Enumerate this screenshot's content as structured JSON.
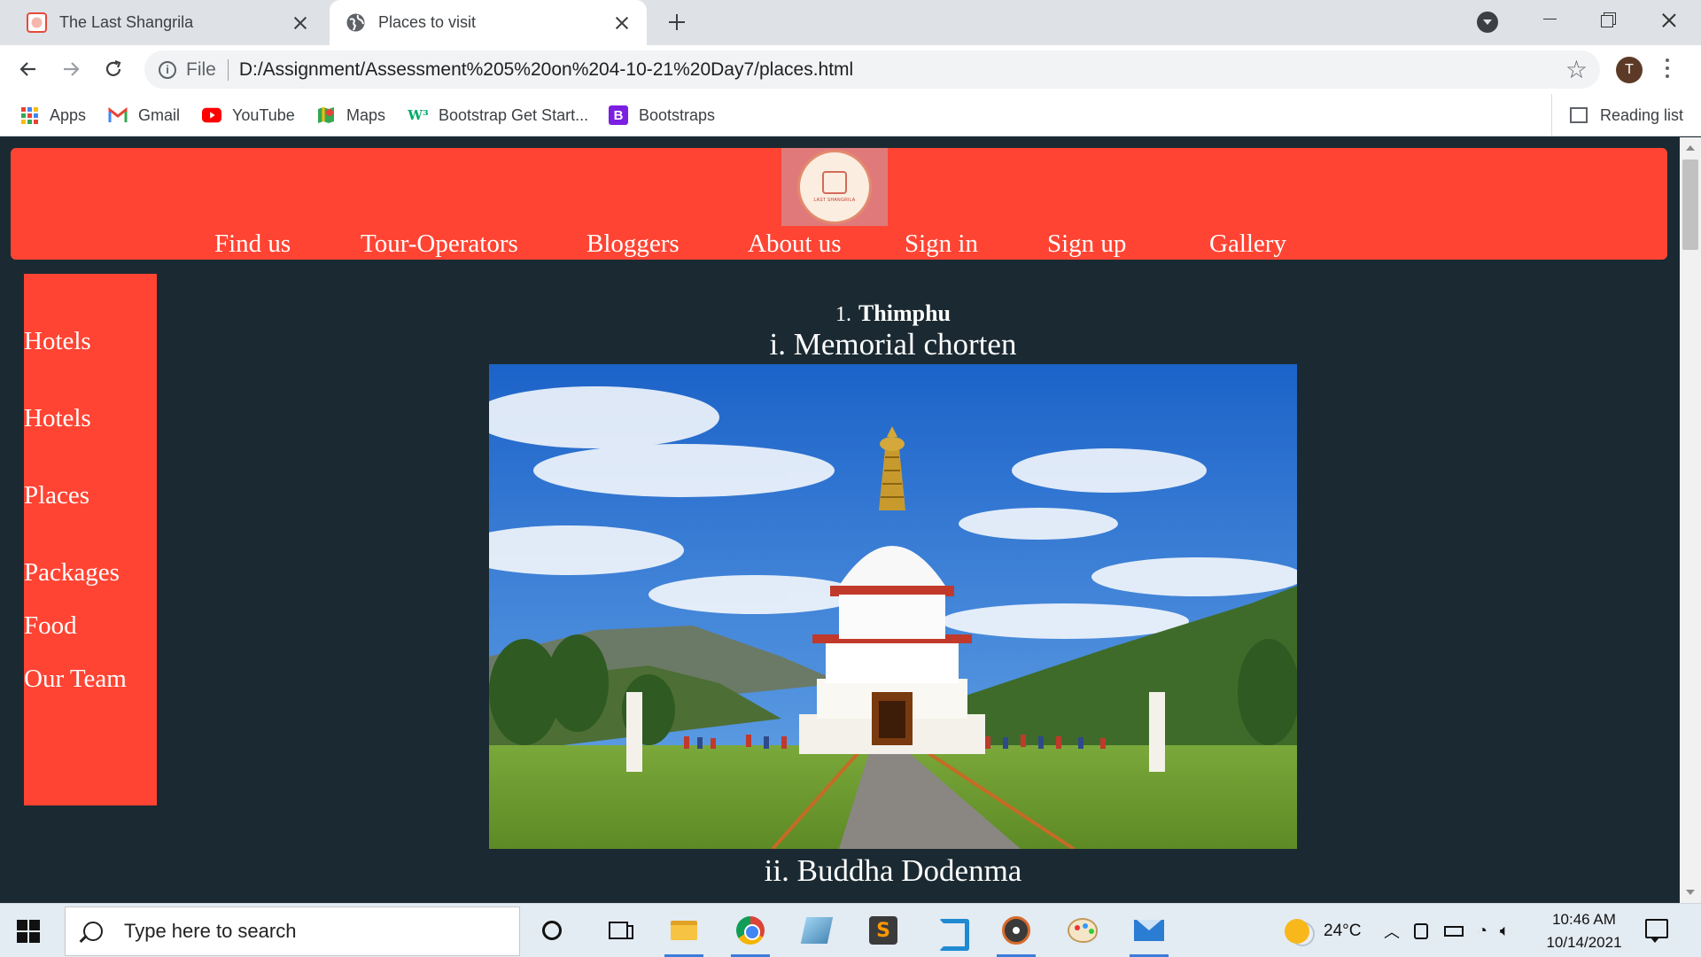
{
  "browser": {
    "tabs": [
      {
        "title": "The Last Shangrila",
        "active": false
      },
      {
        "title": "Places to visit",
        "active": true
      }
    ],
    "address": {
      "scheme": "File",
      "url": "D:/Assignment/Assessment%205%20on%204-10-21%20Day7/places.html"
    },
    "profile_initial": "T",
    "bookmarks": [
      {
        "label": "Apps",
        "icon": "apps-grid-icon"
      },
      {
        "label": "Gmail",
        "icon": "gmail-icon"
      },
      {
        "label": "YouTube",
        "icon": "youtube-icon"
      },
      {
        "label": "Maps",
        "icon": "maps-icon"
      },
      {
        "label": "Bootstrap Get Start...",
        "icon": "w3schools-icon"
      },
      {
        "label": "Bootstraps",
        "icon": "bootstrap-icon"
      }
    ],
    "reading_list": "Reading list"
  },
  "site": {
    "logo_text": "LAST SHANGRILA",
    "topnav": [
      "Find us",
      "Tour-Operators",
      "Bloggers",
      "About us",
      "Sign in",
      "Sign up",
      "Gallery"
    ],
    "sidebar": [
      "Hotels",
      "Hotels",
      "Places",
      "Packages",
      "Food",
      "Our Team"
    ],
    "region": {
      "number": "1.",
      "name": "Thimphu"
    },
    "places": [
      {
        "number": "i.",
        "name": "Memorial chorten"
      },
      {
        "number": "ii.",
        "name": "Buddha Dodenma"
      }
    ]
  },
  "taskbar": {
    "search_placeholder": "Type here to search",
    "weather": "24°C",
    "time": "10:46 AM",
    "date": "10/14/2021"
  },
  "colors": {
    "page_bg": "#1b2a32",
    "accent": "#ff4433",
    "text": "#ffffff"
  }
}
